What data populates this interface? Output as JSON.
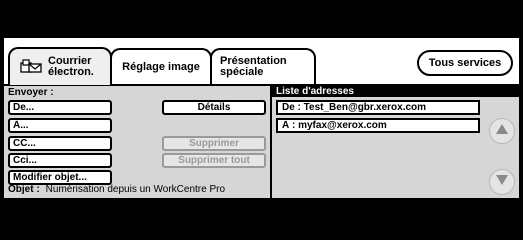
{
  "tabs": [
    {
      "line1": "Courrier",
      "line2": "électron."
    },
    {
      "label": "Réglage image"
    },
    {
      "line1": "Présentation",
      "line2": "spéciale"
    }
  ],
  "all_services_label": "Tous services",
  "send": {
    "label": "Envoyer :",
    "from_button": "De...",
    "to_button": "À...",
    "cc_button": "CC...",
    "bcc_button": "Cci...",
    "modify_subject_button": "Modifier objet...",
    "details_button": "Détails",
    "delete_button": "Supprimer",
    "delete_all_button": "Supprimer tout",
    "subject_label": "Objet :",
    "subject_value": "Numérisation depuis un WorkCentre Pro"
  },
  "address_list": {
    "header": "Liste d'adresses",
    "entries": [
      "De : Test_Ben@gbr.xerox.com",
      "À : myfax@xerox.com"
    ]
  },
  "icons": {
    "mail": "mail-icon",
    "scroll_up": "scroll-up-icon",
    "scroll_down": "scroll-down-icon"
  }
}
